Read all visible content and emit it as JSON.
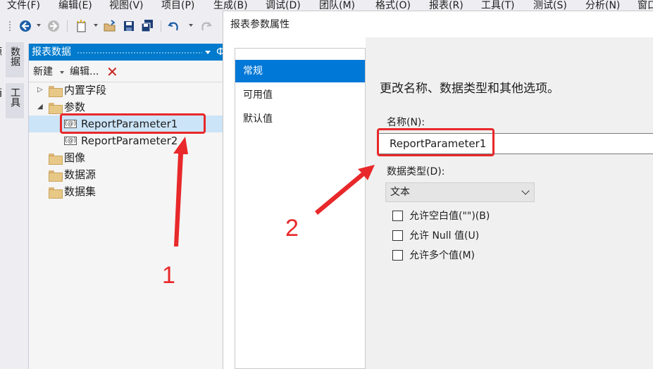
{
  "menu": [
    "文件(F)",
    "编辑(E)",
    "视图(V)",
    "项目(P)",
    "生成(B)",
    "调试(D)",
    "团队(M)",
    "格式(O)",
    "报表(R)",
    "工具(T)",
    "测试(S)",
    "分析(N)",
    "窗口"
  ],
  "toolbar": {
    "icons": [
      "back-icon",
      "forward-icon",
      "new-item-icon",
      "open-folder-icon",
      "save-icon",
      "save-all-icon",
      "undo-icon",
      "redo-icon"
    ]
  },
  "side_tabs": [
    "数据源",
    "工具箱"
  ],
  "report_data": {
    "title": "报表数据",
    "title_trunc": "Ф",
    "new_label": "新建",
    "edit_label": "编辑...",
    "delete_mark": "✕",
    "tree": [
      {
        "label": "内置字段",
        "type": "folder",
        "expanded": false
      },
      {
        "label": "参数",
        "type": "folder",
        "expanded": true
      },
      {
        "label": "ReportParameter1",
        "type": "param",
        "selected": true
      },
      {
        "label": "ReportParameter2",
        "type": "param",
        "selected": false
      },
      {
        "label": "图像",
        "type": "folder"
      },
      {
        "label": "数据源",
        "type": "folder"
      },
      {
        "label": "数据集",
        "type": "folder"
      }
    ]
  },
  "dialog": {
    "title": "报表参数属性",
    "nav": [
      "常规",
      "可用值",
      "默认值"
    ],
    "active_nav": "常规",
    "description": "更改名称、数据类型和其他选项。",
    "name_label": "名称(N):",
    "name_value": "ReportParameter1",
    "type_label": "数据类型(D):",
    "type_value": "文本",
    "checkboxes": [
      "允许空白值(\"\")(B)",
      "允许 Null 值(U)",
      "允许多个值(M)"
    ]
  },
  "annotations": {
    "num1": "1",
    "num2": "2",
    "color": "#e8282a"
  },
  "colors": {
    "accent": "#007acc",
    "nav_active": "#0078d7",
    "selection": "#cce4f7"
  }
}
